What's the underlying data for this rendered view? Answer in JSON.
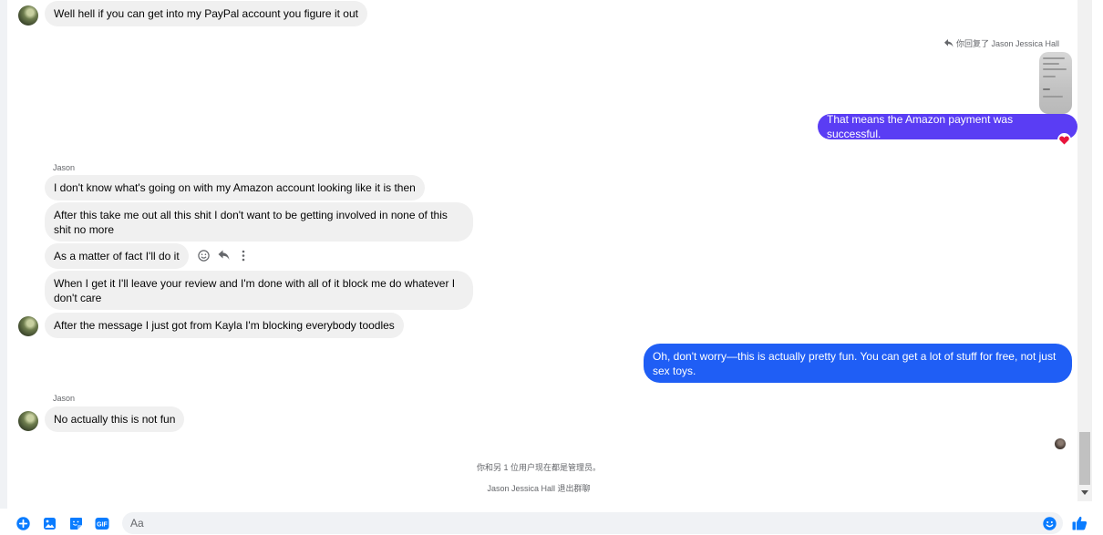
{
  "messages": {
    "m1": "Well hell if you can get into my PayPal account you figure it out",
    "reply_note": "你回复了 Jason Jessica Hall",
    "m2": "That means the Amazon payment was successful.",
    "sender_1": "Jason",
    "m3": "I don't know what's going on with my Amazon account looking like it is then",
    "m4": "After this take me out all this shit I don't want to be getting involved in none of this shit no more",
    "m5": "As a matter of fact I'll do it",
    "m6": "When I get it I'll leave your review and I'm done with all of it block me do whatever I don't care",
    "m7": "After the message I just got from Kayla I'm blocking everybody toodles",
    "m8": "Oh, don't worry—this is actually pretty fun. You can get a lot of stuff for free, not just sex toys.",
    "sender_2": "Jason",
    "m9": "No actually this is not fun"
  },
  "system": {
    "admins": "你和另 1 位用户现在都是管理员。",
    "left": "Jason Jessica Hall 退出群聊"
  },
  "composer": {
    "placeholder": "Aa"
  },
  "colors": {
    "outgoing_purple": "#5a3df4",
    "outgoing_blue": "#1f5ef5",
    "incoming": "#f0f0f0",
    "accent": "#0a7cff"
  },
  "icons": [
    "reply-icon",
    "heart-reaction-icon",
    "emoji-icon",
    "more-icon",
    "add-icon",
    "image-icon",
    "sticker-icon",
    "gif-icon",
    "like-icon"
  ]
}
